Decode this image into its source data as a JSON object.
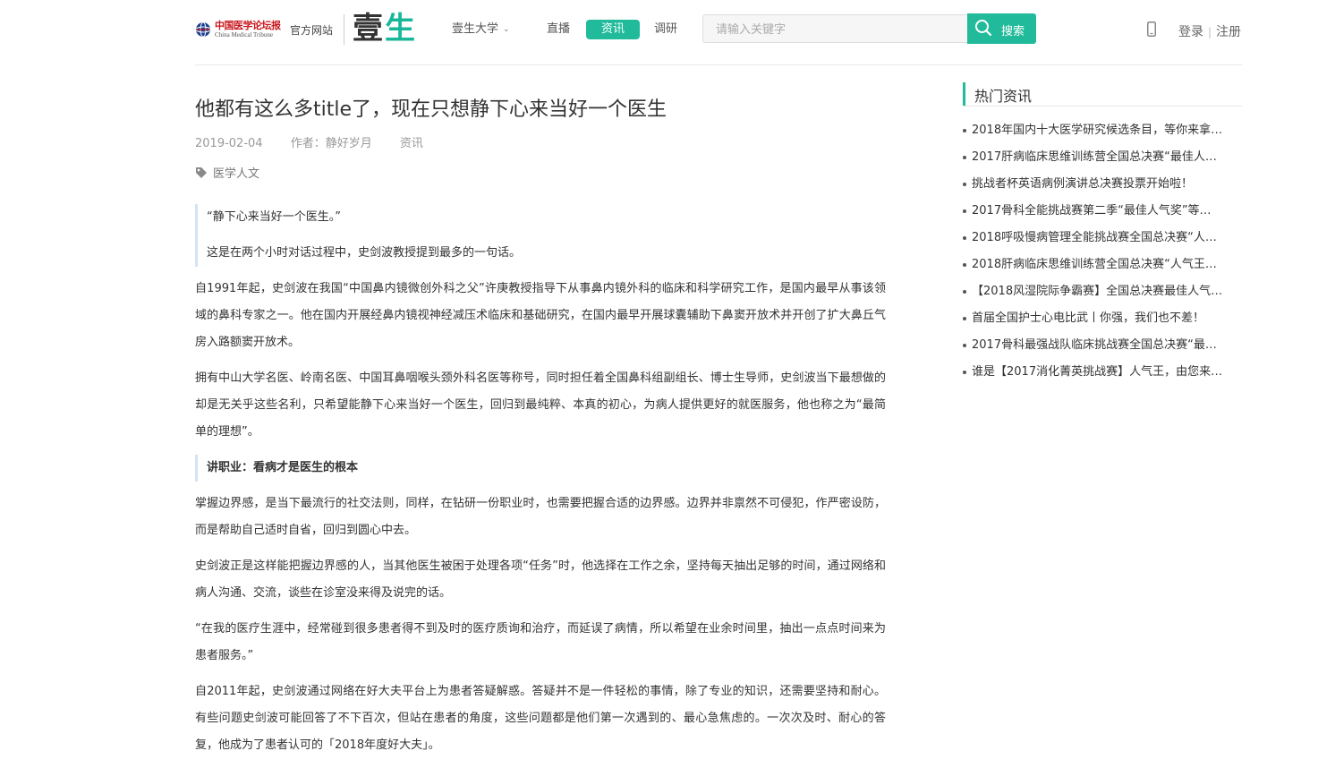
{
  "header": {
    "logo_cn": "中国医学论坛报",
    "logo_en": "China Medical Tribune",
    "official_site": "官方网站",
    "brand_part1": "壹",
    "brand_part2": "生",
    "nav": [
      {
        "label": "壹生大学",
        "has_dropdown": true
      },
      {
        "label": "直播"
      },
      {
        "label": "资讯",
        "active": true
      },
      {
        "label": "调研"
      }
    ],
    "search_placeholder": "请输入关键字",
    "search_button": "搜索",
    "login": "登录",
    "separator": "|",
    "register": "注册",
    "accent_color": "#21bb9b"
  },
  "article": {
    "title": "他都有这么多title了，现在只想静下心来当好一个医生",
    "date": "2019-02-04",
    "author": "作者：静好岁月",
    "category": "资讯",
    "tag": "医学人文",
    "quote1": "“静下心来当好一个医生。”",
    "quote2": "这是在两个小时对话过程中，史剑波教授提到最多的一句话。",
    "para1": "自1991年起，史剑波在我国“中国鼻内镜微创外科之父”许庚教授指导下从事鼻内镜外科的临床和科学研究工作，是国内最早从事该领域的鼻科专家之一。他在国内开展经鼻内镜视神经减压术临床和基础研究，在国内最早开展球囊辅助下鼻窦开放术并开创了扩大鼻丘气房入路额窦开放术。",
    "para2": "拥有中山大学名医、岭南名医、中国耳鼻咽喉头颈外科名医等称号，同时担任着全国鼻科组副组长、博士生导师，史剑波当下最想做的却是无关乎这些名利，只希望能静下心来当好一个医生，回归到最纯粹、本真的初心，为病人提供更好的就医服务，他也称之为“最简单的理想”。",
    "section_heading": "讲职业：看病才是医生的根本",
    "para3": "掌握边界感，是当下最流行的社交法则，同样，在钻研一份职业时，也需要把握合适的边界感。边界并非禀然不可侵犯，作严密设防，而是帮助自己适时自省，回归到圆心中去。",
    "para4": "史剑波正是这样能把握边界感的人，当其他医生被困于处理各项“任务”时，他选择在工作之余，坚持每天抽出足够的时间，通过网络和病人沟通、交流，谈些在诊室没来得及说完的话。",
    "para5": "“在我的医疗生涯中，经常碰到很多患者得不到及时的医疗质询和治疗，而延误了病情，所以希望在业余时间里，抽出一点点时间来为患者服务。”",
    "para6": "自2011年起，史剑波通过网络在好大夫平台上为患者答疑解惑。答疑并不是一件轻松的事情，除了专业的知识，还需要坚持和耐心。有些问题史剑波可能回答了不下百次，但站在患者的角度，这些问题都是他们第一次遇到的、最心急焦虑的。一次次及时、耐心的答复，他成为了患者认可的「2018年度好大夫」。"
  },
  "sidebar": {
    "heading": "热门资讯",
    "items": [
      "2018年国内十大医学研究候选条目，等你来拿…",
      "2017肝病临床思维训练营全国总决赛“最佳人…",
      "挑战者杯英语病例演讲总决赛投票开始啦！",
      "2017骨科全能挑战赛第二季“最佳人气奖”等…",
      "2018呼吸慢病管理全能挑战赛全国总决赛“人…",
      "2018肝病临床思维训练营全国总决赛“人气王…",
      "【2018风湿院际争霸赛】全国总决赛最佳人气…",
      "首届全国护士心电比武丨你强，我们也不差！",
      "2017骨科最强战队临床挑战赛全国总决赛“最…",
      "谁是【2017消化菁英挑战赛】人气王，由您来…"
    ]
  }
}
